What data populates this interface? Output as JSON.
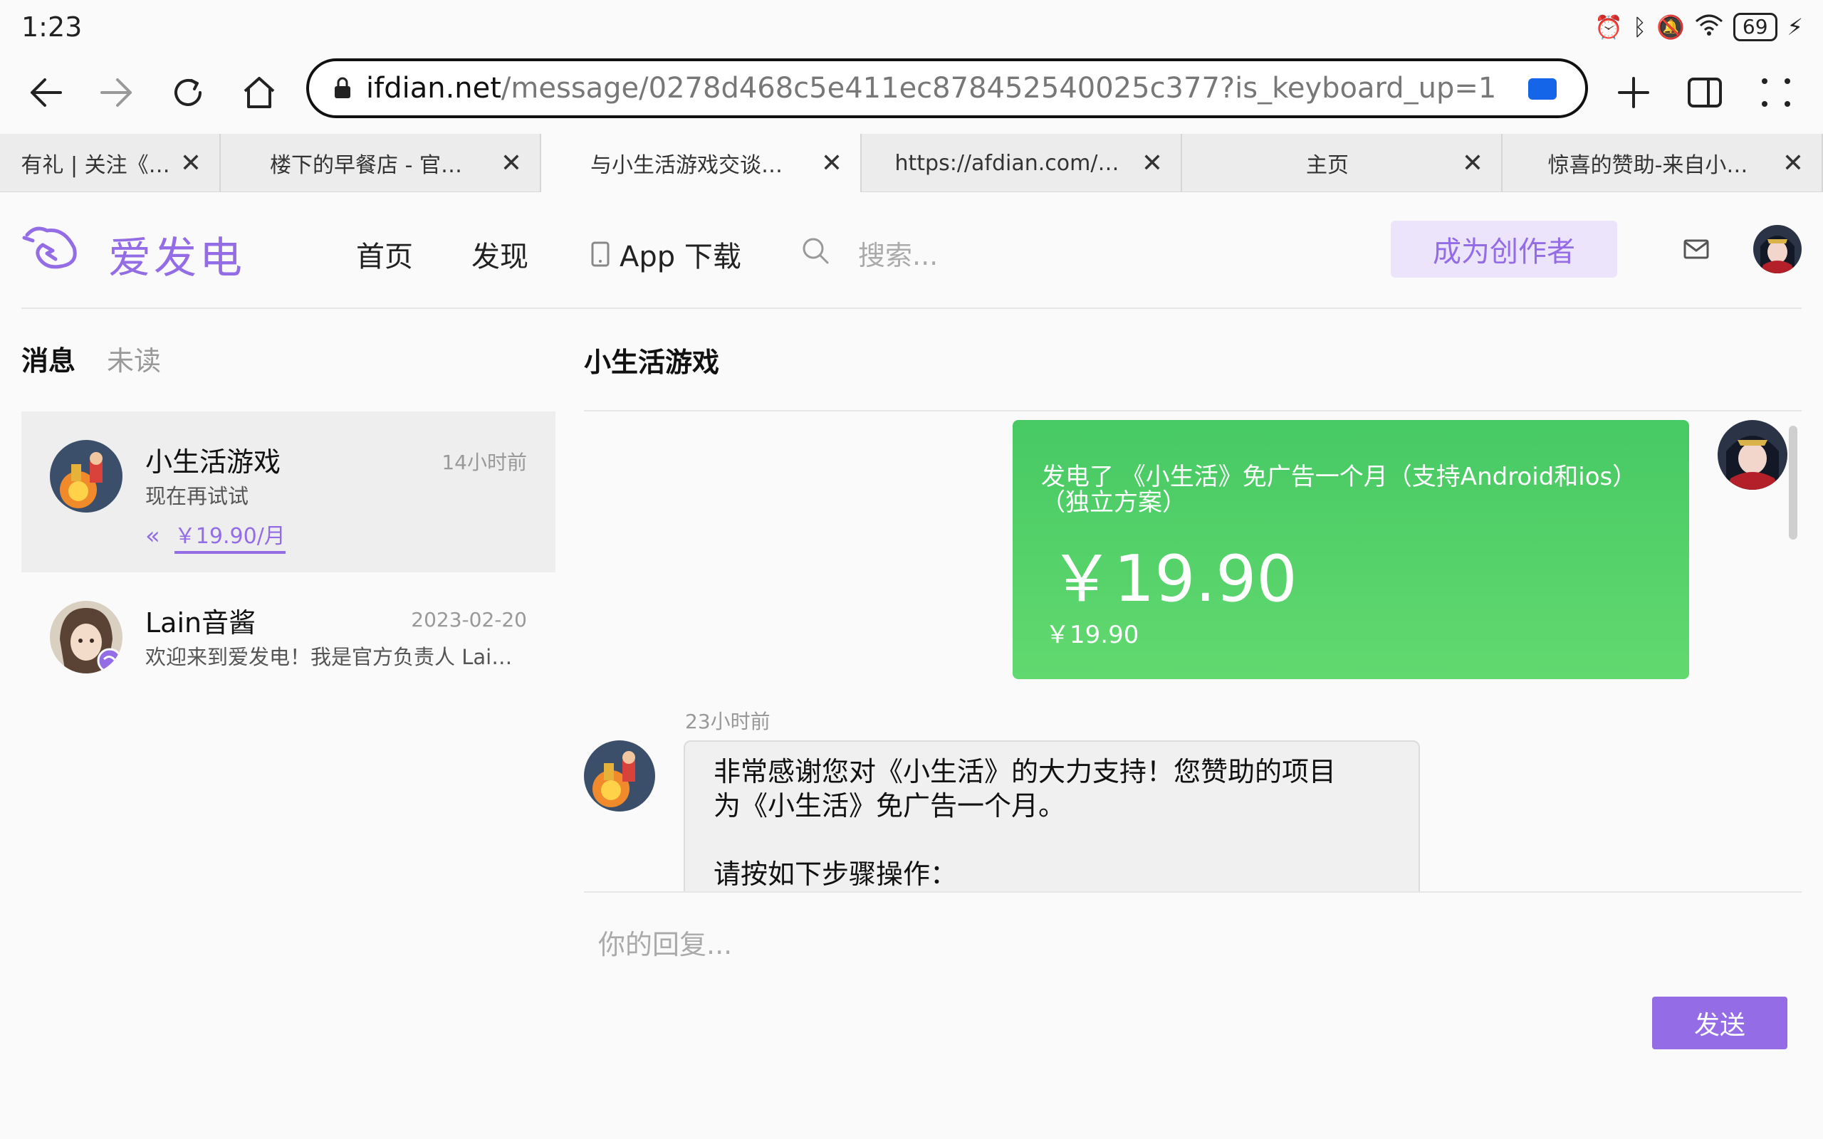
{
  "status": {
    "time": "1:23",
    "battery": "69"
  },
  "browser": {
    "url_host": "ifdian.net",
    "url_path": "/message/0278d468c5e411ec878452540025c377?is_keyboard_up=1",
    "tabs": [
      {
        "title": "有礼 | 关注《…",
        "active": false
      },
      {
        "title": "楼下的早餐店 - 官…",
        "active": false
      },
      {
        "title": "与小生活游戏交谈…",
        "active": true
      },
      {
        "title": "https://afdian.com/…",
        "active": false
      },
      {
        "title": "主页",
        "active": false
      },
      {
        "title": "惊喜的赞助-来自小…",
        "active": false
      }
    ],
    "tab_close_glyph": "✕"
  },
  "site": {
    "logo_text": "爱发电",
    "nav": {
      "home": "首页",
      "discover": "发现",
      "app": "App 下载"
    },
    "search_placeholder": "搜索...",
    "creator_button": "成为创作者"
  },
  "inbox": {
    "tab_messages": "消息",
    "tab_unread": "未读",
    "conversations": [
      {
        "name": "小生活游戏",
        "time": "14小时前",
        "preview": "现在再试试",
        "order_price": "￥19.90/月",
        "order_chevron": "«"
      },
      {
        "name": "Lain音酱",
        "time": "2023-02-20",
        "preview": "欢迎来到爱发电！我是官方负责人 Lai…"
      }
    ]
  },
  "chat": {
    "title": "小生活游戏",
    "order_card": {
      "description": "发电了 《小生活》免广告一个月（支持Android和ios）（独立方案）",
      "amount": "￥19.90",
      "small_amount": "￥19.90"
    },
    "message_time": "23小时前",
    "message_lines": [
      "非常感谢您对《小生活》的大力支持！您赞助的项目",
      "为《小生活》免广告一个月。",
      "",
      "请按如下步骤操作："
    ],
    "reply_placeholder": "你的回复...",
    "send_button": "发送"
  },
  "colors": {
    "brand_purple": "#946ce6",
    "card_green": "#4fcf68",
    "cast_blue": "#1565e8"
  }
}
